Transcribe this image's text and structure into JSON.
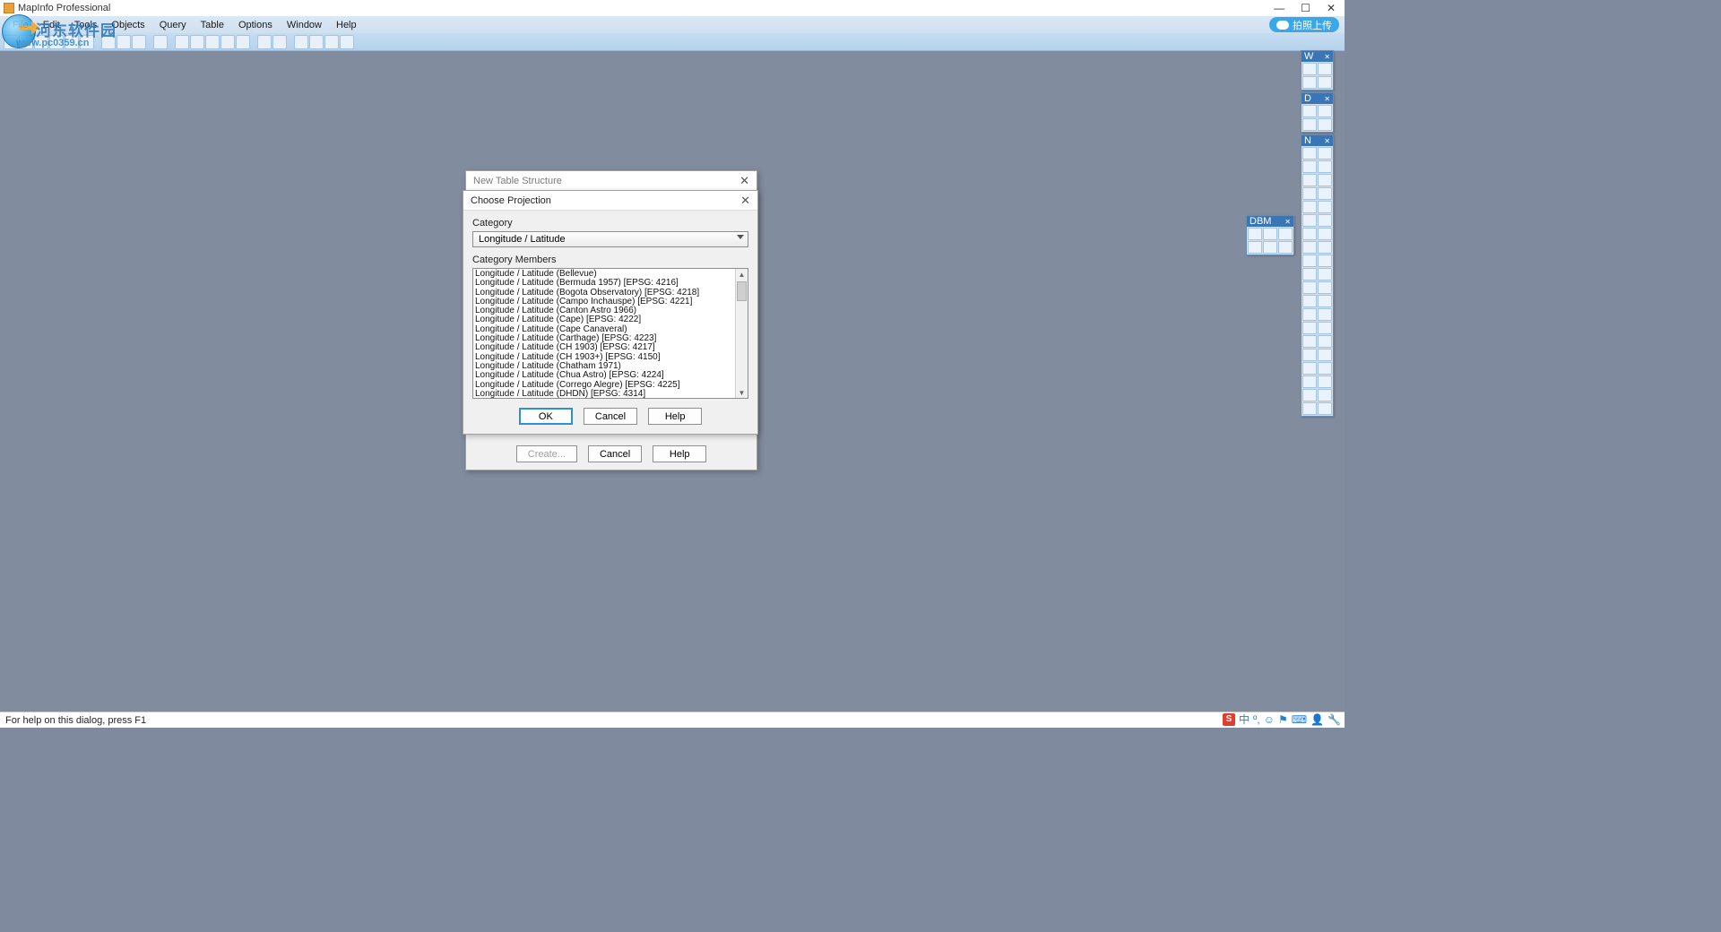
{
  "app": {
    "title": "MapInfo Professional"
  },
  "window_controls": {
    "min": "—",
    "max": "☐",
    "close": "✕"
  },
  "menu": [
    "File",
    "Edit",
    "Tools",
    "Objects",
    "Query",
    "Table",
    "Options",
    "Window",
    "Help"
  ],
  "upload": {
    "label": "拍照上传"
  },
  "watermark": {
    "brand": "河东软件园",
    "url": "www.pc0359.cn"
  },
  "statusbar": {
    "text": "For help on this dialog, press F1"
  },
  "palettes": {
    "w": {
      "title": "W",
      "close": "✕"
    },
    "d": {
      "title": "D",
      "close": "✕"
    },
    "n": {
      "title": "N",
      "close": "✕"
    },
    "dbm": {
      "title": "DBM",
      "close": "✕"
    }
  },
  "dlg_nts": {
    "title": "New Table Structure",
    "buttons": {
      "create": "Create...",
      "cancel": "Cancel",
      "help": "Help"
    }
  },
  "dlg_cp": {
    "title": "Choose Projection",
    "category_label": "Category",
    "category_value": "Longitude / Latitude",
    "members_label": "Category Members",
    "members": [
      "Longitude / Latitude (Bellevue)",
      "Longitude / Latitude (Bermuda 1957) [EPSG: 4216]",
      "Longitude / Latitude (Bogota Observatory) [EPSG: 4218]",
      "Longitude / Latitude (Campo Inchauspe) [EPSG: 4221]",
      "Longitude / Latitude (Canton Astro 1966)",
      "Longitude / Latitude (Cape) [EPSG: 4222]",
      "Longitude / Latitude (Cape Canaveral)",
      "Longitude / Latitude (Carthage) [EPSG: 4223]",
      "Longitude / Latitude (CH 1903) [EPSG: 4217]",
      "Longitude / Latitude (CH 1903+) [EPSG: 4150]",
      "Longitude / Latitude (Chatham 1971)",
      "Longitude / Latitude (Chua Astro) [EPSG: 4224]",
      "Longitude / Latitude (Corrego Alegre) [EPSG: 4225]",
      "Longitude / Latitude (DHDN) [EPSG: 4314]"
    ],
    "buttons": {
      "ok": "OK",
      "cancel": "Cancel",
      "help": "Help"
    }
  },
  "tray": {
    "ime": "中",
    "sogou": "S"
  }
}
